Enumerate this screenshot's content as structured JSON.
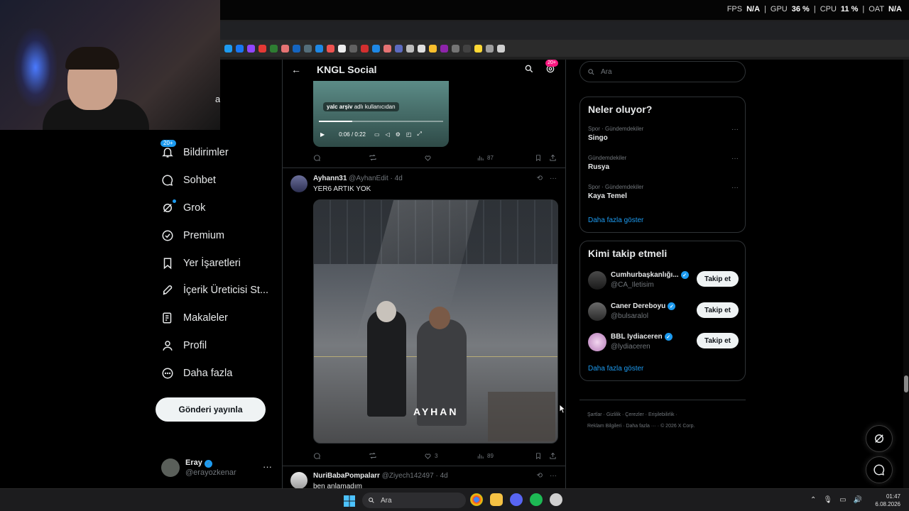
{
  "stats": {
    "fps_label": "FPS",
    "fps_value": "N/A",
    "gpu_label": "GPU",
    "gpu_value": "36 %",
    "cpu_label": "CPU",
    "cpu_value": "11 %",
    "sep": "|",
    "oat_label": "OAT",
    "oat_value": "N/A"
  },
  "sidebar": {
    "items": [
      {
        "label": "Bildirimler",
        "badge": "20+"
      },
      {
        "label": "Sohbet"
      },
      {
        "label": "Grok"
      },
      {
        "label": "Premium"
      },
      {
        "label": "Yer İşaretleri"
      },
      {
        "label": "İçerik Üreticisi St..."
      },
      {
        "label": "Makaleler"
      },
      {
        "label": "Profil"
      },
      {
        "label": "Daha fazla"
      }
    ],
    "post_button": "Gönderi yayınla",
    "account": {
      "name": "Eray",
      "handle": "@erayozkenar",
      "more": "···"
    },
    "webcam_fragment": "a"
  },
  "header": {
    "back": "←",
    "title": "KNGL Social",
    "badge": "20+"
  },
  "video": {
    "credit_user": "yalc arşiv",
    "credit_suffix": "adlı kullanıcıdan",
    "time": "0:06 / 0:22",
    "progress": 0.27,
    "views": "87"
  },
  "tweets": [
    {
      "author": "Ayhann31",
      "handle": "@AyhanEdit",
      "age": "· 4d",
      "text": "YER6 ARTIK YOK",
      "likes": "3",
      "views": "89",
      "media_overlay": "AYHAN"
    },
    {
      "author": "NuriBabaPompalarr",
      "handle": "@Ziyech142497",
      "age": "· 4d",
      "text": "ben anlamadım"
    }
  ],
  "right": {
    "search_placeholder": "Ara",
    "trends_title": "Neler oluyor?",
    "trends": [
      {
        "category": "Spor · Gündemdekiler",
        "name": "Singo"
      },
      {
        "category": "Gündemdekiler",
        "name": "Rusya"
      },
      {
        "category": "Spor · Gündemdekiler",
        "name": "Kaya Temel"
      }
    ],
    "show_more": "Daha fazla göster",
    "who_title": "Kimi takip etmeli",
    "who": [
      {
        "name": "Cumhurbaşkanlığı...",
        "handle": "@CA_Iletisim",
        "button": "Takip et"
      },
      {
        "name": "Caner Dereboyu",
        "handle": "@bulsaralol",
        "button": "Takip et"
      },
      {
        "name": "BBL Iydiaceren",
        "handle": "@lydiaceren",
        "button": "Takip et"
      }
    ],
    "who_show_more": "Daha fazla göster",
    "footer_line1": "Şartlar  ·  Gizlilik  ·  Çerezler  ·  Erişilebilirlik  ·",
    "footer_line2": "Reklam Bilgileri  ·  Daha fazla ···  ·  © 2026 X Corp."
  },
  "taskbar": {
    "search_label": "Ara",
    "time": "01:47",
    "date": "6.08.2026"
  },
  "colors": {
    "accent": "#1d9bf0",
    "notification_pink": "#f91880",
    "background": "#000000",
    "border": "#2f3336"
  }
}
